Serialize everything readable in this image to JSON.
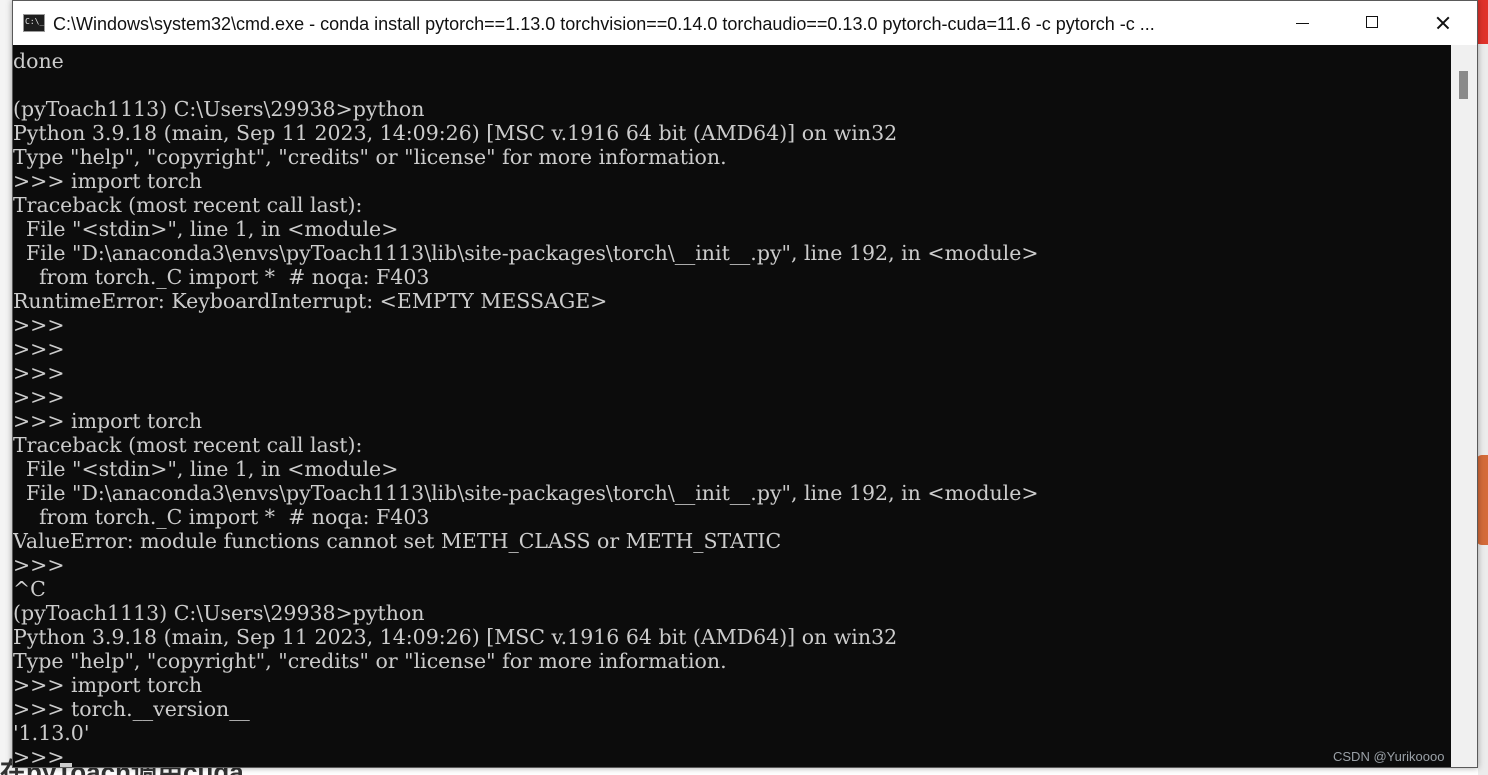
{
  "window": {
    "title": "C:\\Windows\\system32\\cmd.exe - conda  install pytorch==1.13.0 torchvision==0.14.0 torchaudio==0.13.0 pytorch-cuda=11.6 -c pytorch -c ...",
    "icon": "cmd-icon",
    "controls": {
      "minimize": "minimize-icon",
      "maximize": "maximize-icon",
      "close": "close-icon"
    }
  },
  "console": {
    "lines": [
      "done",
      "",
      "(pyToach1113) C:\\Users\\29938>python",
      "Python 3.9.18 (main, Sep 11 2023, 14:09:26) [MSC v.1916 64 bit (AMD64)] on win32",
      "Type \"help\", \"copyright\", \"credits\" or \"license\" for more information.",
      ">>> import torch",
      "Traceback (most recent call last):",
      "  File \"<stdin>\", line 1, in <module>",
      "  File \"D:\\anaconda3\\envs\\pyToach1113\\lib\\site-packages\\torch\\__init__.py\", line 192, in <module>",
      "    from torch._C import *  # noqa: F403",
      "RuntimeError: KeyboardInterrupt: <EMPTY MESSAGE>",
      ">>>",
      ">>>",
      ">>>",
      ">>>",
      ">>> import torch",
      "Traceback (most recent call last):",
      "  File \"<stdin>\", line 1, in <module>",
      "  File \"D:\\anaconda3\\envs\\pyToach1113\\lib\\site-packages\\torch\\__init__.py\", line 192, in <module>",
      "    from torch._C import *  # noqa: F403",
      "ValueError: module functions cannot set METH_CLASS or METH_STATIC",
      ">>>",
      "^C",
      "(pyToach1113) C:\\Users\\29938>python",
      "Python 3.9.18 (main, Sep 11 2023, 14:09:26) [MSC v.1916 64 bit (AMD64)] on win32",
      "Type \"help\", \"copyright\", \"credits\" or \"license\" for more information.",
      ">>> import torch",
      ">>> torch.__version__",
      "'1.13.0'",
      ">>>"
    ]
  },
  "background": {
    "bottom_text": "在pyToach调用cuda",
    "watermark": "CSDN @Yurikoooo"
  },
  "colors": {
    "console_bg": "#0c0c0c",
    "console_fg": "#cccccc",
    "titlebar_bg": "#ffffff"
  }
}
